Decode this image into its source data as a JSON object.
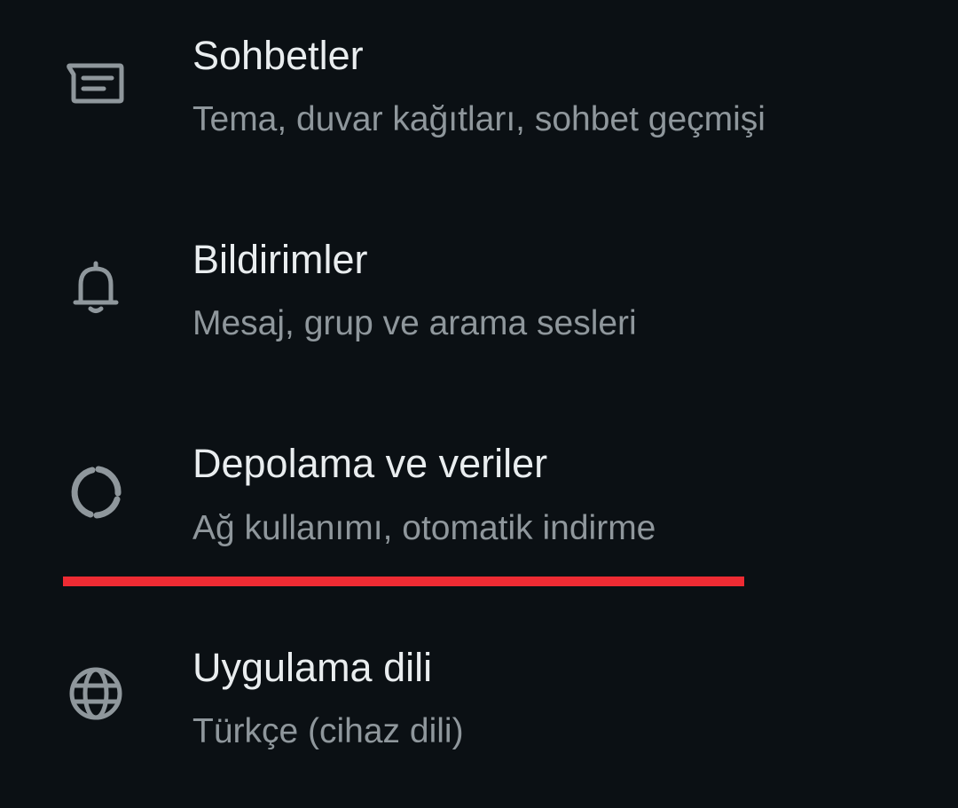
{
  "settings_list": {
    "items": [
      {
        "title": "Sohbetler",
        "subtitle": "Tema, duvar kağıtları, sohbet geçmişi",
        "icon": "chat-icon"
      },
      {
        "title": "Bildirimler",
        "subtitle": "Mesaj, grup ve arama sesleri",
        "icon": "bell-icon"
      },
      {
        "title": "Depolama ve veriler",
        "subtitle": "Ağ kullanımı, otomatik indirme",
        "icon": "data-usage-icon"
      },
      {
        "title": "Uygulama dili",
        "subtitle": "Türkçe (cihaz dili)",
        "icon": "globe-icon"
      }
    ]
  },
  "colors": {
    "background": "#0b1014",
    "title_text": "#e9edef",
    "subtitle_text": "#8f979c",
    "icon": "#8f979c",
    "highlight_underline": "#ee2b33"
  }
}
